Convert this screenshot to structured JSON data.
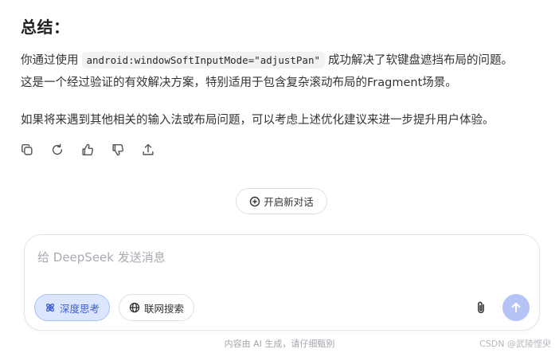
{
  "message": {
    "heading": "总结：",
    "p1_line1_before": "你通过使用",
    "p1_code": "android:windowSoftInputMode=\"adjustPan\"",
    "p1_line1_after": "成功解决了软键盘遮挡布局的问题。",
    "p1_line2": "这是一个经过验证的有效解决方案，特别适用于包含复杂滚动布局的Fragment场景。",
    "p2": "如果将来遇到其他相关的输入法或布局问题，可以考虑上述优化建议来进一步提升用户体验。"
  },
  "actions": [
    {
      "name": "copy",
      "icon": "copy-icon"
    },
    {
      "name": "regenerate",
      "icon": "refresh-icon"
    },
    {
      "name": "like",
      "icon": "thumbs-up-icon"
    },
    {
      "name": "dislike",
      "icon": "thumbs-down-icon"
    },
    {
      "name": "share",
      "icon": "share-icon"
    }
  ],
  "new_chat": {
    "label": "开启新对话",
    "icon": "plus-circle-icon"
  },
  "composer": {
    "placeholder": "给 DeepSeek 发送消息",
    "deep_think": {
      "label": "深度思考",
      "icon": "atom-icon",
      "active": true
    },
    "web_search": {
      "label": "联网搜索",
      "icon": "globe-icon",
      "active": false
    },
    "attach_icon": "paperclip-icon",
    "send_icon": "arrow-up-icon"
  },
  "footer": {
    "disclaimer": "内容由 AI 生成，请仔细甄别",
    "watermark": "CSDN @武陵悭臾"
  },
  "colors": {
    "accent": "#3c5fd0",
    "chip_active_bg": "#dbe6fe",
    "send_bg": "#b5c3f7"
  }
}
